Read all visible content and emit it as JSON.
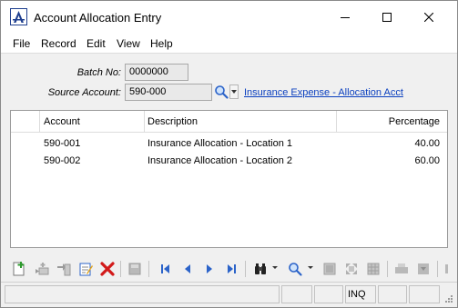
{
  "window": {
    "title": "Account Allocation Entry"
  },
  "menu": {
    "items": [
      "File",
      "Record",
      "Edit",
      "View",
      "Help"
    ]
  },
  "form": {
    "batch_label": "Batch No:",
    "batch_value": "0000000",
    "source_label": "Source Account:",
    "source_value": "590-000",
    "source_description": "Insurance Expense - Allocation Acct"
  },
  "grid": {
    "columns": [
      "Account",
      "Description",
      "Percentage"
    ],
    "rows": [
      {
        "account": "590-001",
        "description": "Insurance Allocation - Location 1",
        "percentage": "40.00"
      },
      {
        "account": "590-002",
        "description": "Insurance Allocation - Location 2",
        "percentage": "60.00"
      }
    ]
  },
  "status": {
    "mode": "INQ"
  },
  "colors": {
    "link": "#0a3fbf",
    "delete_red": "#d21a1a",
    "nav_blue": "#2b63c9",
    "add_green": "#2e9b2e"
  }
}
